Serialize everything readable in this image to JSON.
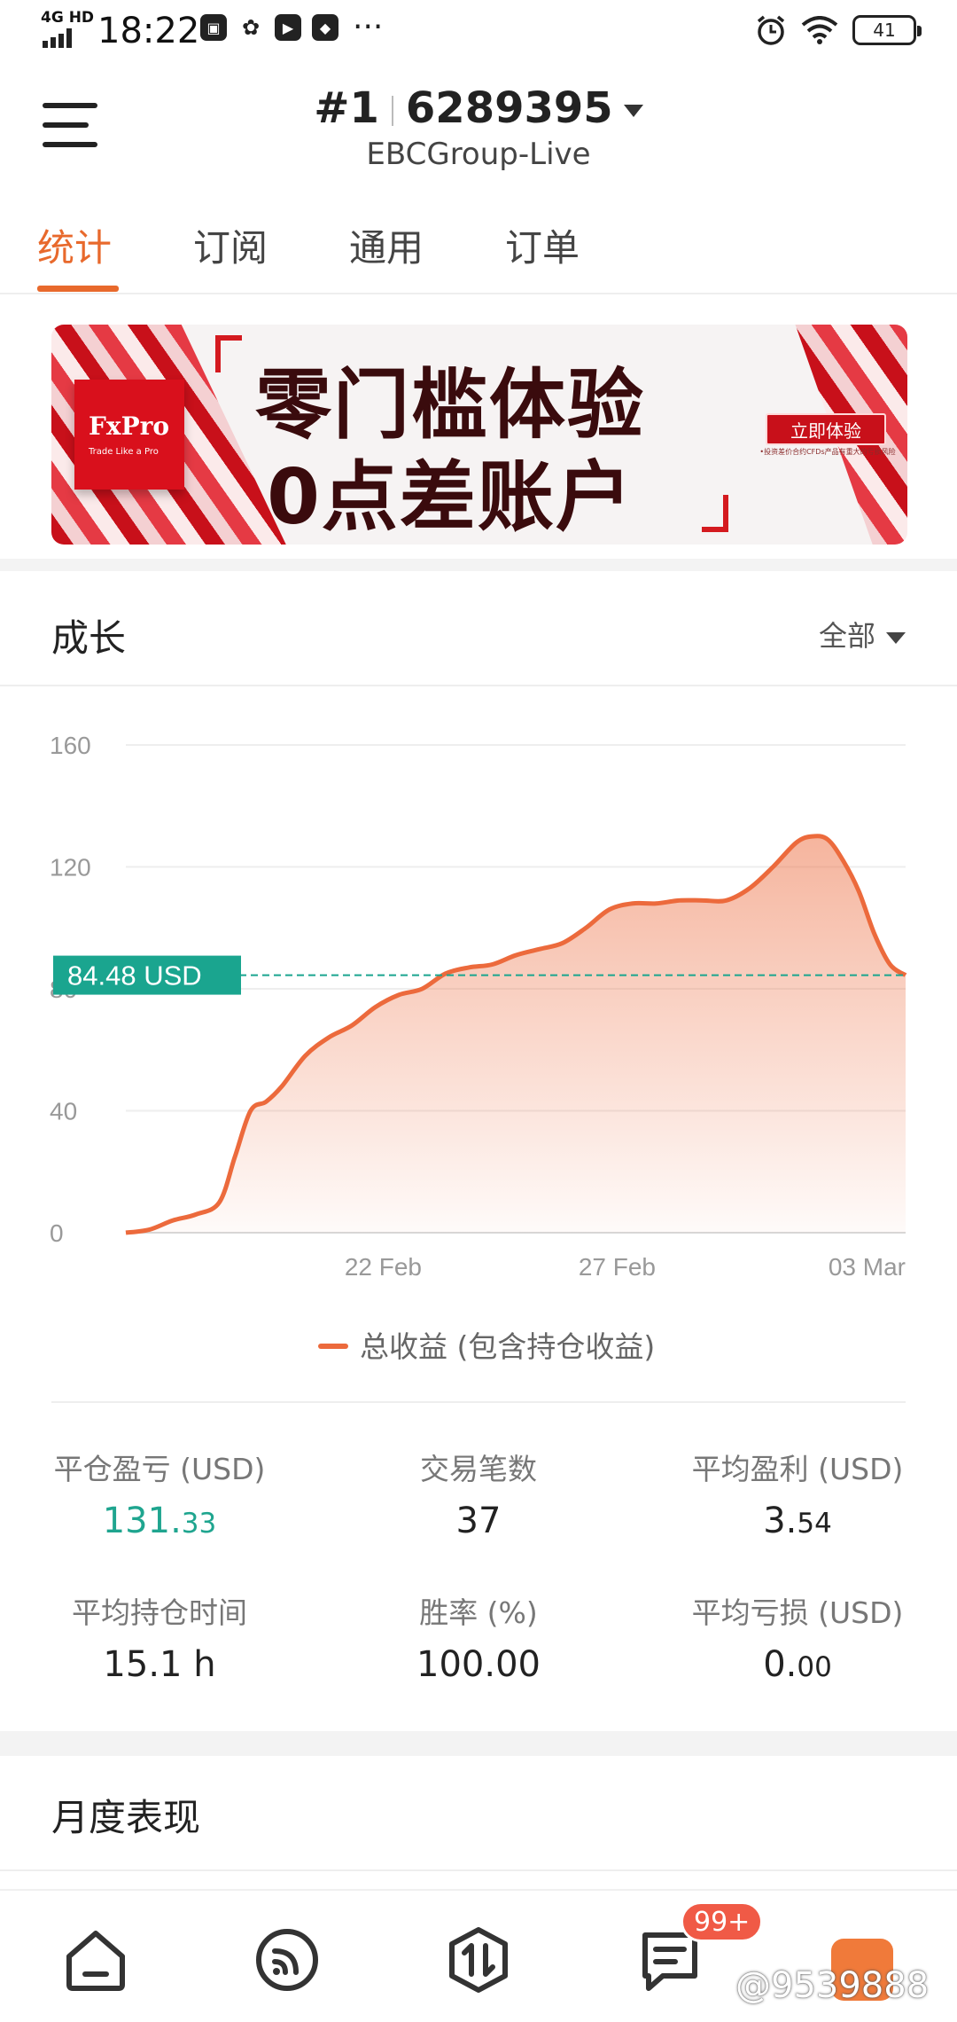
{
  "status_bar": {
    "time": "18:22",
    "network": "4G HD",
    "battery": "41",
    "more": "···"
  },
  "header": {
    "account_rank": "#1",
    "account_id": "6289395",
    "server": "EBCGroup-Live"
  },
  "tabs": [
    {
      "label": "统计",
      "active": true
    },
    {
      "label": "订阅",
      "active": false
    },
    {
      "label": "通用",
      "active": false
    },
    {
      "label": "订单",
      "active": false
    }
  ],
  "banner": {
    "brand": "FxPro",
    "brand_tagline": "Trade Like a Pro",
    "headline_1": "零门槛体验",
    "headline_2": "0点差账户",
    "cta": "立即体验",
    "subtext": "•投资差价合约CFDs产品有重大的亏损风险"
  },
  "growth": {
    "title": "成长",
    "filter": "全部"
  },
  "chart_data": {
    "type": "area",
    "y_ticks": [
      "0",
      "40",
      "80",
      "120",
      "160"
    ],
    "ylim": [
      0,
      160
    ],
    "x_ticks": [
      "22 Feb",
      "27 Feb",
      "03 Mar"
    ],
    "current_value_label": "84.48 USD",
    "current_value": 84.48,
    "legend": "总收益 (包含持仓收益)",
    "series_color": "#ec6a3c",
    "reference_color": "#1aa58f",
    "series": [
      {
        "name": "总收益 (包含持仓收益)",
        "x": [
          0,
          0.03,
          0.06,
          0.09,
          0.12,
          0.14,
          0.16,
          0.18,
          0.2,
          0.23,
          0.26,
          0.29,
          0.32,
          0.35,
          0.38,
          0.41,
          0.44,
          0.47,
          0.5,
          0.53,
          0.56,
          0.59,
          0.62,
          0.65,
          0.68,
          0.71,
          0.74,
          0.77,
          0.8,
          0.83,
          0.86,
          0.88,
          0.9,
          0.92,
          0.94,
          0.96,
          0.98,
          1.0
        ],
        "y": [
          0,
          1,
          4,
          6,
          10,
          25,
          40,
          43,
          48,
          58,
          64,
          68,
          74,
          78,
          80,
          85,
          87,
          88,
          91,
          93,
          95,
          100,
          106,
          108,
          108,
          109,
          109,
          109,
          113,
          120,
          128,
          130,
          129,
          122,
          112,
          98,
          88,
          84.48
        ]
      }
    ]
  },
  "stats": [
    {
      "label": "平仓盈亏 (USD)",
      "int": "131.",
      "dec": "33",
      "positive": true
    },
    {
      "label": "交易笔数",
      "int": "37",
      "dec": "",
      "positive": false
    },
    {
      "label": "平均盈利 (USD)",
      "int": "3.",
      "dec": "54",
      "positive": false
    },
    {
      "label": "平均持仓时间",
      "int": "15.1 h",
      "dec": "",
      "positive": false
    },
    {
      "label": "胜率 (%)",
      "int": "100.00",
      "dec": "",
      "positive": false
    },
    {
      "label": "平均亏损 (USD)",
      "int": "0.",
      "dec": "00",
      "positive": false
    }
  ],
  "monthly": {
    "title": "月度表现"
  },
  "bottom_nav": {
    "badge": "99+",
    "watermark": "@9539888"
  }
}
